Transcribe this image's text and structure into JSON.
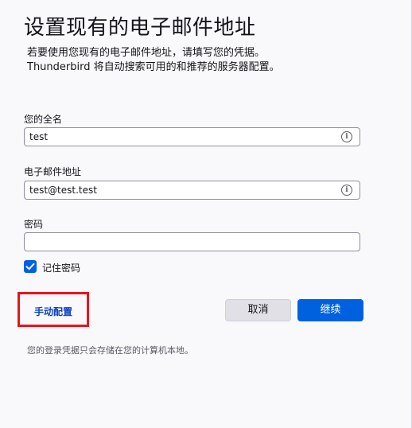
{
  "header": {
    "title": "设置现有的电子邮件地址",
    "subtitle_line1": "若要使用您现有的电子邮件地址，请填写您的凭据。",
    "subtitle_line2": "Thunderbird 将自动搜索可用的和推荐的服务器配置。"
  },
  "form": {
    "name_label": "您的全名",
    "name_value": "test",
    "email_label": "电子邮件地址",
    "email_value": "test@test.test",
    "password_label": "密码",
    "password_value": "",
    "remember_label": "记住密码",
    "remember_checked": true
  },
  "actions": {
    "manual_config_label": "手动配置",
    "cancel_label": "取消",
    "continue_label": "继续"
  },
  "footnote": "您的登录凭据只会存储在您的计算机本地。",
  "icons": {
    "info": "info-icon",
    "check": "checkmark-icon"
  },
  "colors": {
    "accent": "#0061e0",
    "highlight_border": "#e8141e",
    "manual_link": "#0b3fc0"
  }
}
